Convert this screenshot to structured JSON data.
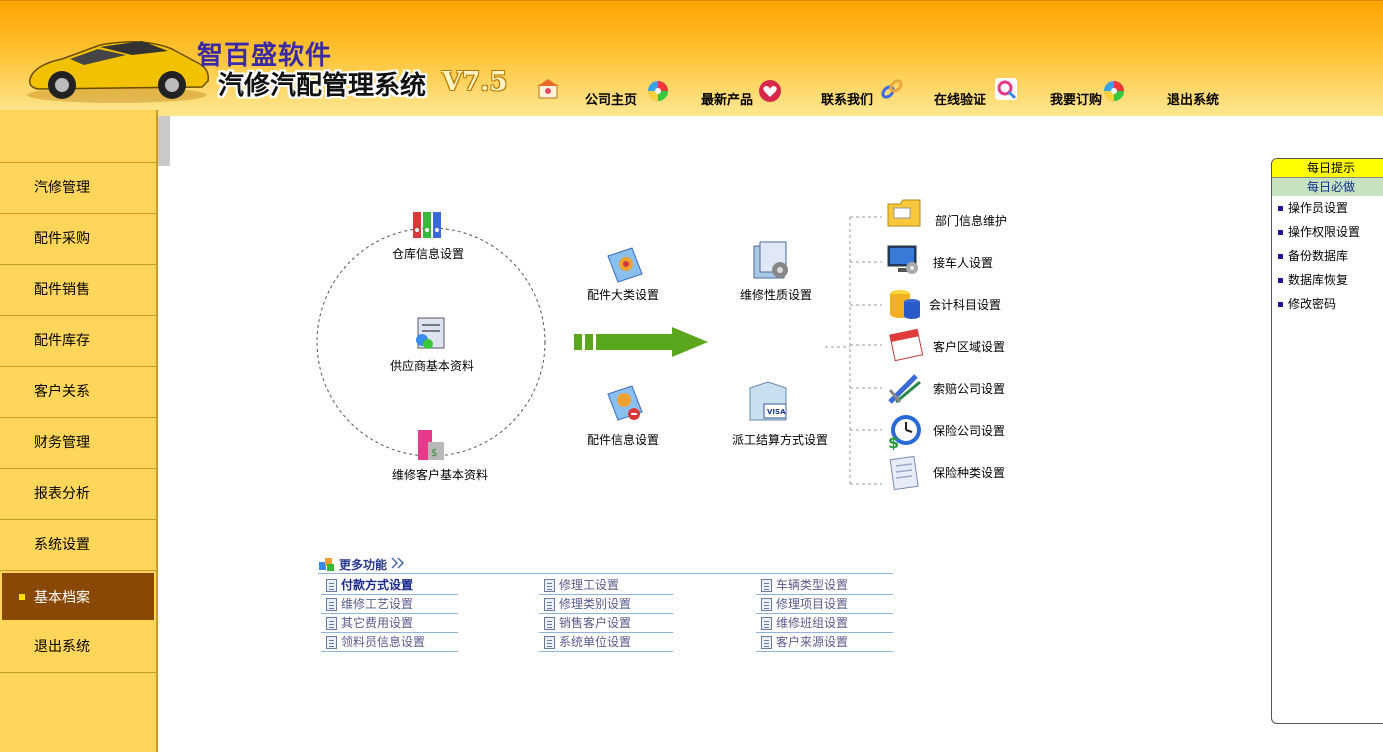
{
  "header": {
    "brand": "智百盛软件",
    "system_title": "汽修汽配管理系统",
    "version": "V7.5",
    "nav": [
      {
        "label": "公司主页",
        "icon": "house-icon"
      },
      {
        "label": "最新产品",
        "icon": "colorwheel-icon"
      },
      {
        "label": "联系我们",
        "icon": "heart-icon"
      },
      {
        "label": "在线验证",
        "icon": "chain-icon"
      },
      {
        "label": "我要订购",
        "icon": "magnifier-icon"
      },
      {
        "label": "退出系统",
        "icon": "colorwheel-icon"
      }
    ]
  },
  "sidebar": {
    "items": [
      {
        "label": "汽修管理"
      },
      {
        "label": "配件采购"
      },
      {
        "label": "配件销售"
      },
      {
        "label": "配件库存"
      },
      {
        "label": "客户关系"
      },
      {
        "label": "财务管理"
      },
      {
        "label": "报表分析"
      },
      {
        "label": "系统设置"
      },
      {
        "label": "基本档案",
        "active": true
      },
      {
        "label": "退出系统"
      }
    ]
  },
  "diagram": {
    "circle_items": [
      "仓库信息设置",
      "供应商基本资料",
      "维修客户基本资料"
    ],
    "middle_items": [
      "配件大类设置",
      "配件信息设置"
    ],
    "center_items": [
      "维修性质设置",
      "派工结算方式设置"
    ],
    "right_items": [
      "部门信息维护",
      "接车人设置",
      "会计科目设置",
      "客户区域设置",
      "索赔公司设置",
      "保险公司设置",
      "保险种类设置"
    ]
  },
  "tips": {
    "header1": "每日提示",
    "header2": "每日必做",
    "items": [
      "操作员设置",
      "操作权限设置",
      "备份数据库",
      "数据库恢复",
      "修改密码"
    ]
  },
  "more": {
    "title": "更多功能",
    "columns": [
      [
        "付款方式设置",
        "维修工艺设置",
        "其它费用设置",
        "领料员信息设置"
      ],
      [
        "修理工设置",
        "修理类别设置",
        "销售客户设置",
        "系统单位设置"
      ],
      [
        "车辆类型设置",
        "修理项目设置",
        "维修班组设置",
        "客户来源设置"
      ]
    ]
  },
  "colors": {
    "header_orange": "#ffa400",
    "sidebar_bg": "#ffd65a",
    "sidebar_active": "#8a4806",
    "arrow_green": "#5aa61c",
    "tips_yellow": "#ffff00"
  }
}
